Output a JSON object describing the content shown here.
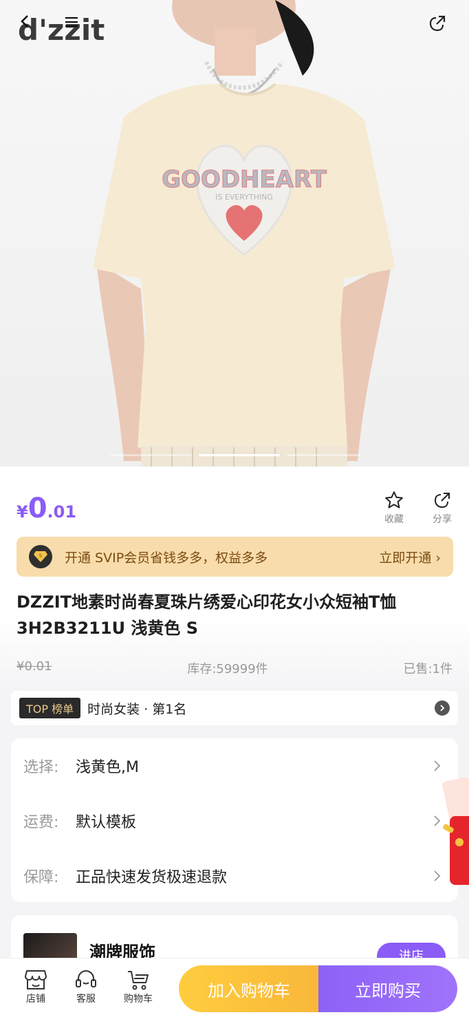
{
  "header": {
    "brand_logo": "d'zzit",
    "share_icon": "share-icon"
  },
  "product_image": {
    "print_text_main": "GOODHEART",
    "print_text_sub": "IS EVERYTHING",
    "carousel_count": 3,
    "carousel_active": 2
  },
  "price": {
    "currency": "¥",
    "integer": "0",
    "decimal": ".01"
  },
  "actions": {
    "favorite_label": "收藏",
    "share_label": "分享"
  },
  "svip": {
    "text": "开通 SVIP会员省钱多多，权益多多",
    "cta": "立即开通 ›"
  },
  "product": {
    "title": "DZZIT地素时尚春夏珠片绣爱心印花女小众短袖T恤 3H2B3211U 浅黄色 S",
    "original_price": "¥0.01",
    "stock": "库存:59999件",
    "sold": "已售:1件"
  },
  "ranking": {
    "badge": "TOP 榜单",
    "text": "时尚女装 · 第1名"
  },
  "options": [
    {
      "key": "选择:",
      "value": "浅黄色,M"
    },
    {
      "key": "运费:",
      "value": "默认模板"
    },
    {
      "key": "保障:",
      "value": "正品快速发货极速退款"
    }
  ],
  "store": {
    "name": "潮牌服饰",
    "enter_label": "进店"
  },
  "bottom_bar": {
    "store_label": "店铺",
    "service_label": "客服",
    "cart_label": "购物车",
    "add_to_cart": "加入购物车",
    "buy_now": "立即购买"
  },
  "colors": {
    "accent": "#8b5cf6",
    "svip_bg": "#f8dcab",
    "cart_button": "#ffc13d"
  }
}
